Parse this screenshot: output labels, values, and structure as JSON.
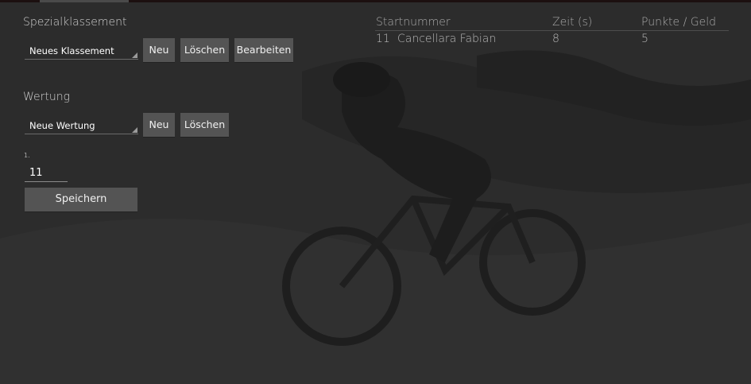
{
  "spezial": {
    "title": "Spezialklassement",
    "selected": "Neues Klassement",
    "buttons": {
      "neu": "Neu",
      "loeschen": "Löschen",
      "bearbeiten": "Bearbeiten"
    }
  },
  "wertung": {
    "title": "Wertung",
    "selected": "Neue Wertung",
    "buttons": {
      "neu": "Neu",
      "loeschen": "Löschen"
    }
  },
  "entry": {
    "label": "1.",
    "value": "11",
    "save_label": "Speichern"
  },
  "table": {
    "headers": [
      "Startnummer",
      "Zeit (s)",
      "Punkte / Geld"
    ],
    "rows": [
      {
        "startnummer": "11",
        "name": "Cancellara Fabian",
        "zeit": "8",
        "punkte": "5"
      }
    ]
  },
  "colors": {
    "background": "#2b2b2b",
    "button": "#545454",
    "top_bar": "#1c1010"
  }
}
